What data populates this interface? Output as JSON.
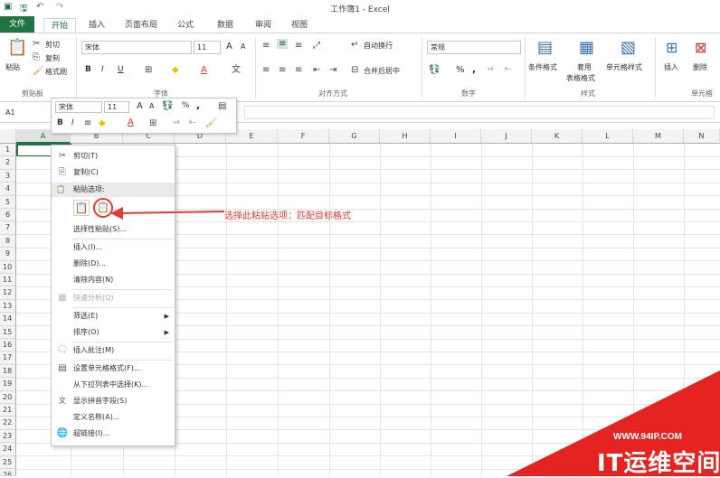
{
  "window": {
    "title": "工作簿1 - Excel"
  },
  "tabs": [
    "文件",
    "开始",
    "插入",
    "页面布局",
    "公式",
    "数据",
    "审阅",
    "视图"
  ],
  "ribbon": {
    "clipboard": {
      "paste": "粘贴",
      "cut": "剪切",
      "copy": "复制",
      "format_painter": "格式刷",
      "label": "剪贴板"
    },
    "font": {
      "name": "宋体",
      "size": "11",
      "bold": "B",
      "italic": "I",
      "underline": "U",
      "grow": "A",
      "shrink": "A",
      "font_color": "A",
      "label": "字体"
    },
    "alignment": {
      "wrap": "自动换行",
      "merge": "合并后居中",
      "label": "对齐方式"
    },
    "number": {
      "format": "常规",
      "percent": "%",
      "comma": ",",
      "label": "数字"
    },
    "styles": {
      "conditional": "条件格式",
      "table1": "套用",
      "table2": "表格格式",
      "cell_styles": "单元格样式",
      "label": "样式"
    },
    "cells": {
      "insert": "插入",
      "delete": "删除",
      "label": "单元格"
    }
  },
  "formula_bar": {
    "name_box": "A1"
  },
  "mini_toolbar": {
    "font": "宋体",
    "size": "11",
    "bold": "B",
    "italic": "I",
    "percent": "%",
    "comma": ",",
    "grow": "A",
    "shrink": "A",
    "font_color": "A"
  },
  "columns": [
    "A",
    "B",
    "C",
    "D",
    "E",
    "F",
    "G",
    "H",
    "I",
    "J",
    "K",
    "L",
    "M",
    "N"
  ],
  "rows": [
    "1",
    "2",
    "3",
    "4",
    "5",
    "6",
    "7",
    "8",
    "9",
    "10",
    "11",
    "12",
    "13",
    "14",
    "15",
    "16",
    "17",
    "18",
    "19",
    "20",
    "21",
    "22",
    "23",
    "24",
    "25",
    "26"
  ],
  "context_menu": {
    "cut": "剪切(T)",
    "copy": "复制(C)",
    "paste_options": "粘贴选项:",
    "paste_special": "选择性粘贴(S)...",
    "insert": "插入(I)...",
    "delete": "删除(D)...",
    "clear": "清除内容(N)",
    "quick_analysis": "快速分析(Q)",
    "filter": "筛选(E)",
    "sort": "排序(O)",
    "insert_comment": "插入批注(M)",
    "format_cells": "设置单元格格式(F)...",
    "pick_list": "从下拉列表中选择(K)...",
    "phonetic": "显示拼音字段(S)",
    "define_name": "定义名称(A)...",
    "hyperlink": "超链接(I)..."
  },
  "annotation": "选择此粘贴选项：匹配目标格式",
  "watermark": {
    "url": "WWW.94IP.COM",
    "brand": "IT运维空间"
  },
  "colors": {
    "excel_green": "#217346",
    "annotation_red": "#e53935",
    "watermark_red": "#e52421"
  }
}
